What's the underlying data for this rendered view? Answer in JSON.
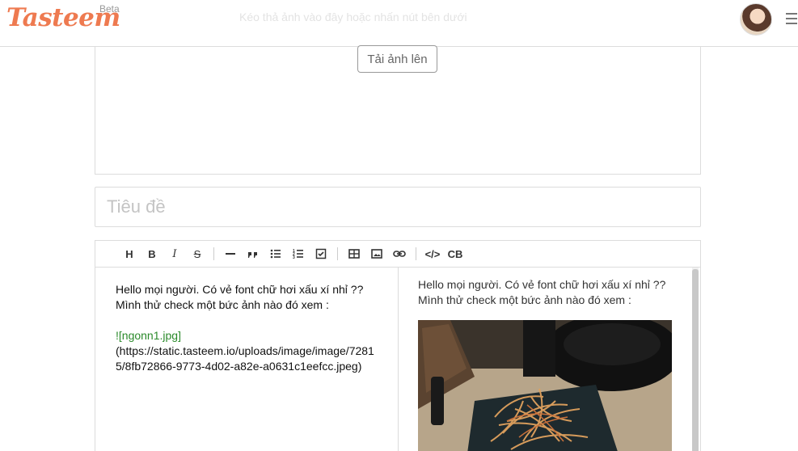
{
  "header": {
    "logo": "Tasteem",
    "beta": "Beta",
    "ghost_hint": "Kéo thả ảnh vào đây hoặc nhấn nút bên dưới"
  },
  "upload": {
    "button_label": "Tải ảnh lên"
  },
  "title_field": {
    "placeholder": "Tiêu đề",
    "value": ""
  },
  "toolbar": {
    "heading": "H",
    "bold": "B",
    "italic": "I",
    "strike": "S",
    "code": "</>",
    "codeblock": "CB"
  },
  "editor": {
    "source_line1": "Hello mọi người. Có vẻ font chữ hơi xấu xí nhỉ ??",
    "source_line2": "Mình thử check một bức ảnh nào đó xem :",
    "image_markdown": "![ngonn1.jpg]",
    "image_url": "(https://static.tasteem.io/uploads/image/image/72815/8fb72866-9773-4d02-a82e-a0631c1eefcc.jpeg)",
    "preview_line1": "Hello mọi người. Có vẻ font chữ hơi xấu xí nhỉ ??",
    "preview_line2": "Mình thử check một bức ảnh nào đó xem :"
  },
  "colors": {
    "brand": "#ee7a50",
    "link": "#2b8a2b",
    "border": "#dcdcdc"
  }
}
